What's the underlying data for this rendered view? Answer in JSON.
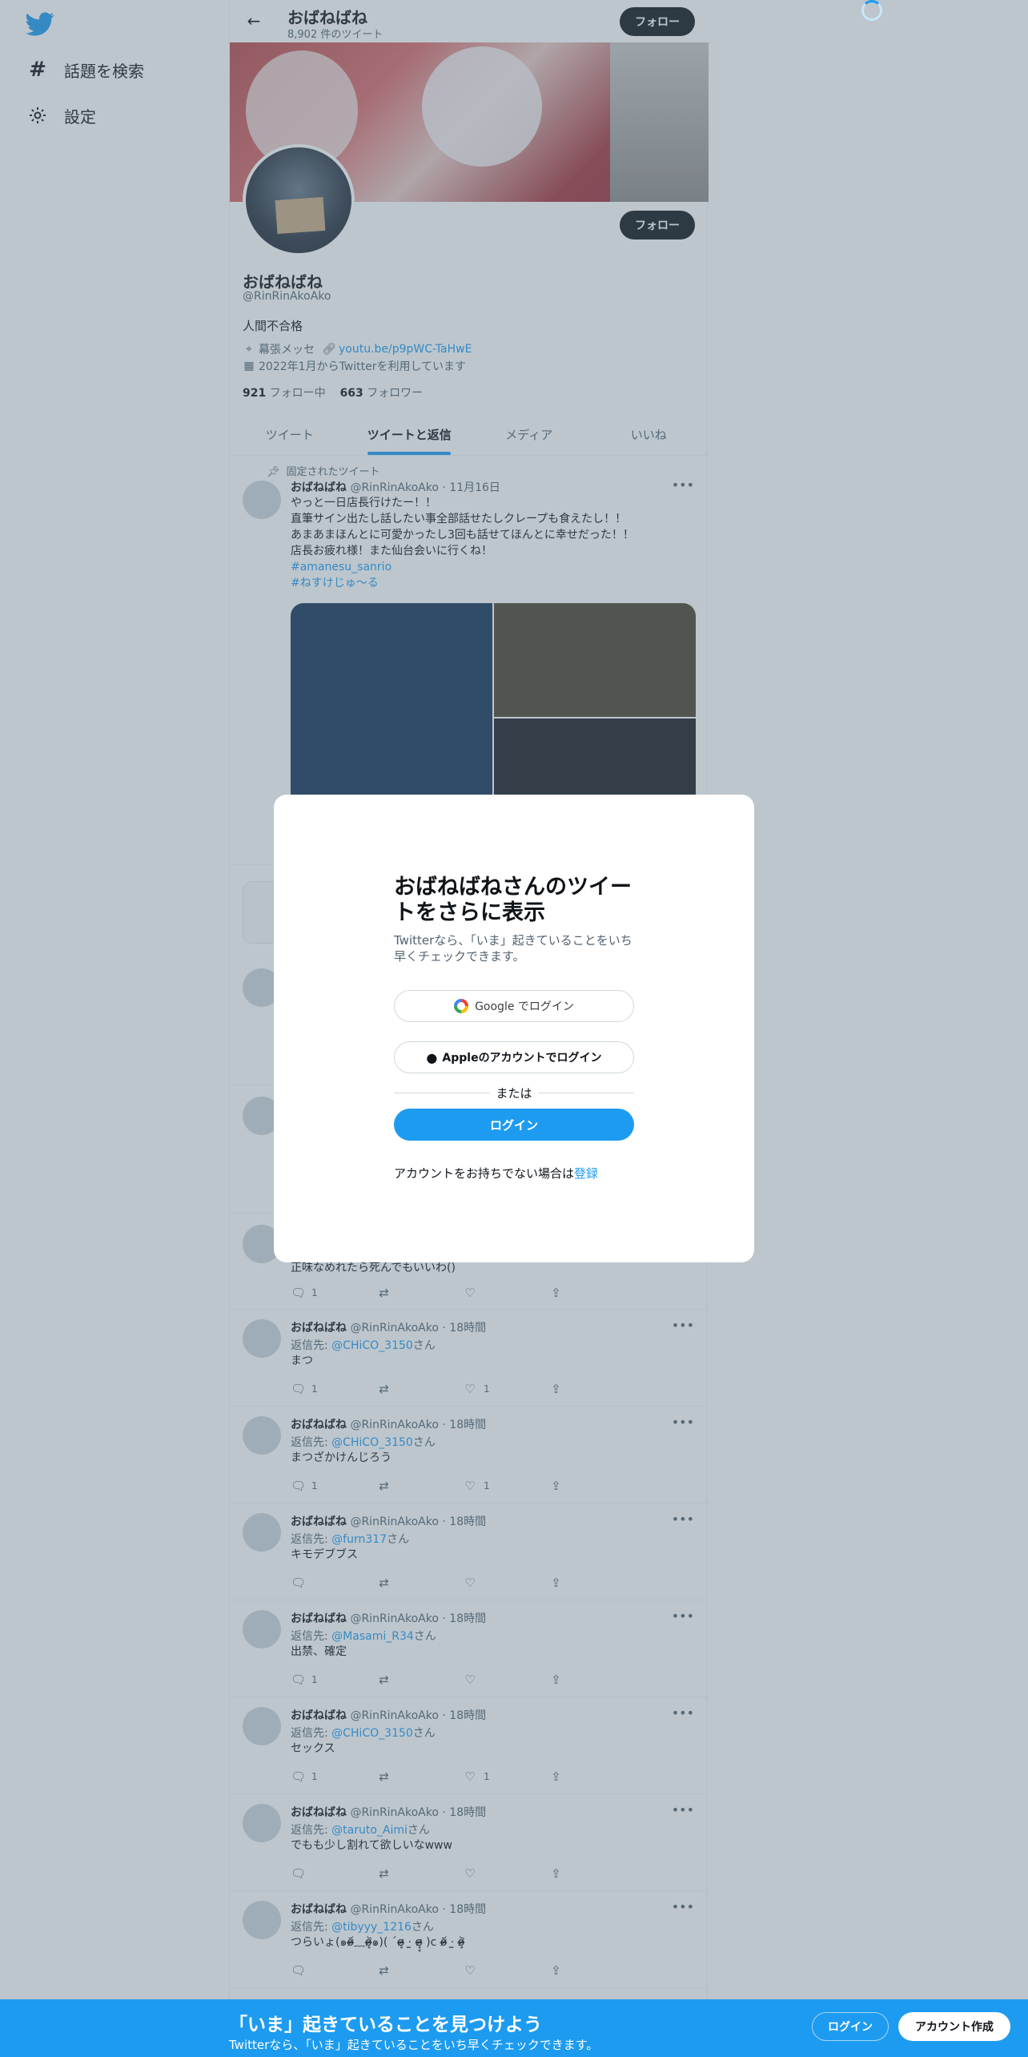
{
  "nav": {
    "items": [
      {
        "label": "話題を検索",
        "icon": "hashtag-icon"
      },
      {
        "label": "設定",
        "icon": "gear-icon"
      }
    ]
  },
  "header": {
    "name": "おばねばね",
    "tweet_count": "8,902 件のツイート",
    "follow_label": "フォロー"
  },
  "profile": {
    "name": "おばねばね",
    "handle": "@RinRinAkoAko",
    "bio": "人間不合格",
    "location": "幕張メッセ",
    "link": "youtu.be/p9pWC-TaHwE",
    "joined": "2022年1月からTwitterを利用しています",
    "following_count": "921",
    "following_label": "フォロー中",
    "followers_count": "663",
    "followers_label": "フォロワー",
    "follow_label": "フォロー"
  },
  "tabs": [
    "ツイート",
    "ツイートと返信",
    "メディア",
    "いいね"
  ],
  "pinned_label": "固定されたツイート",
  "pinned_tweet": {
    "name": "おばねばね",
    "meta": "@RinRinAkoAko · 11月16日",
    "lines": [
      "やっと一日店長行けたー！！",
      "直筆サイン出たし話したい事全部話せたしクレープも食えたし！！",
      "あまあまほんとに可愛かったし3回も話せてほんとに幸せだった！！",
      "店長お疲れ様！また仙台会いに行くね！"
    ],
    "hashtags": [
      "#amanesu_sanrio",
      "#ねすけじゅ〜る"
    ]
  },
  "partial_tweet": {
    "text": "正味なめれたら死んでもいいわ()",
    "replies": "1"
  },
  "tweets": [
    {
      "name": "おばねばね",
      "meta": "@RinRinAkoAko · 18時間",
      "reply_prefix": "返信先: ",
      "reply_to": "@CHiCO_3150",
      "reply_suffix": "さん",
      "text": "まつ",
      "replies": "1",
      "likes": "1"
    },
    {
      "name": "おばねばね",
      "meta": "@RinRinAkoAko · 18時間",
      "reply_prefix": "返信先: ",
      "reply_to": "@CHiCO_3150",
      "reply_suffix": "さん",
      "text": "まつざかけんじろう",
      "replies": "1",
      "likes": "1"
    },
    {
      "name": "おばねばね",
      "meta": "@RinRinAkoAko · 18時間",
      "reply_prefix": "返信先: ",
      "reply_to": "@furn317",
      "reply_suffix": "さん",
      "text": "キモデブブス",
      "replies": "",
      "likes": ""
    },
    {
      "name": "おばねばね",
      "meta": "@RinRinAkoAko · 18時間",
      "reply_prefix": "返信先: ",
      "reply_to": "@Masami_R34",
      "reply_suffix": "さん",
      "text": "出禁、確定",
      "replies": "1",
      "likes": ""
    },
    {
      "name": "おばねばね",
      "meta": "@RinRinAkoAko · 18時間",
      "reply_prefix": "返信先: ",
      "reply_to": "@CHiCO_3150",
      "reply_suffix": "さん",
      "text": "セックス",
      "replies": "1",
      "likes": "1"
    },
    {
      "name": "おばねばね",
      "meta": "@RinRinAkoAko · 18時間",
      "reply_prefix": "返信先: ",
      "reply_to": "@taruto_Aimi",
      "reply_suffix": "さん",
      "text": "でもも少し割れて欲しいなwww",
      "replies": "",
      "likes": ""
    },
    {
      "name": "おばねばね",
      "meta": "@RinRinAkoAko · 18時間",
      "reply_prefix": "返信先: ",
      "reply_to": "@tibyyy_1216",
      "reply_suffix": "さん",
      "text": "つらいょ(๑o̴̶̷᷄﹏o̴̶̷̥᷅๑)( ´ɞ̴̶̷̥ ·̫ ɞ̴̶̷̥̥ )c o̴̶̷᷄ ·̫ o̴̶̷̥᷅",
      "replies": "",
      "likes": ""
    }
  ],
  "modal": {
    "title": "おばねばねさんのツイートをさらに表示",
    "subtitle": "Twitterなら、「いま」起きていることをいち早くチェックできます。",
    "google_label": "Google でログイン",
    "apple_label": "Appleのアカウントでログイン",
    "or_label": "または",
    "login_label": "ログイン",
    "signup_prompt": "アカウントをお持ちでない場合は",
    "signup_link": "登録"
  },
  "bottom_bar": {
    "title": "「いま」起きていることを見つけよう",
    "subtitle": "Twitterなら、「いま」起きていることをいち早くチェックできます。",
    "login_label": "ログイン",
    "signup_label": "アカウント作成"
  },
  "colors": {
    "accent": "#1d9bf0",
    "text": "#0f1419",
    "secondary": "#536471"
  }
}
